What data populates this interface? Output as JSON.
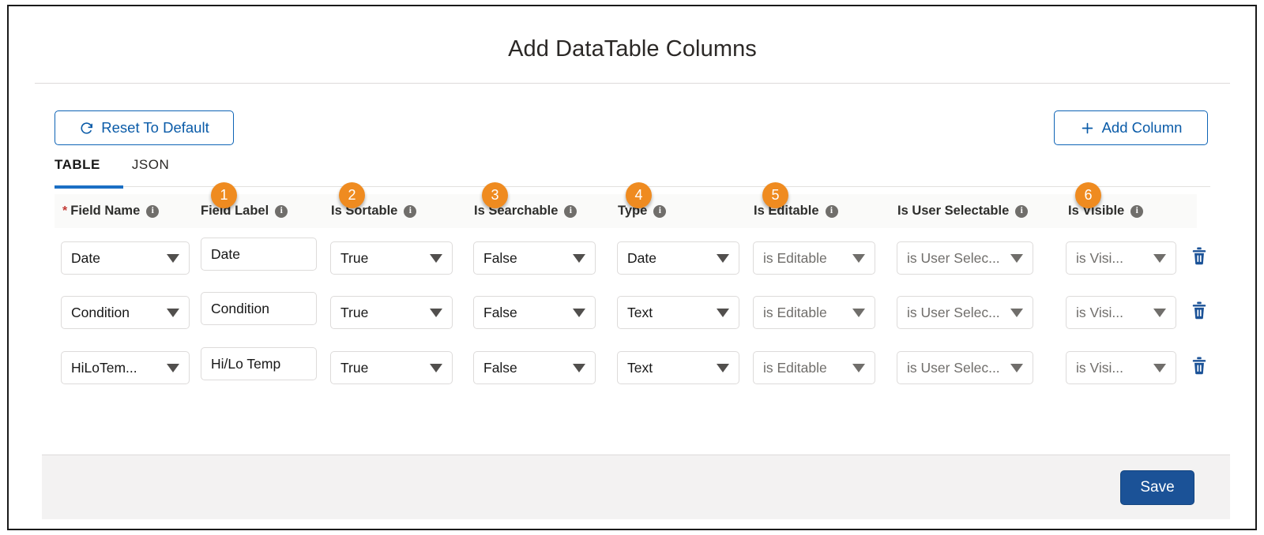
{
  "modal": {
    "title": "Add DataTable Columns"
  },
  "toolbar": {
    "reset_label": "Reset To Default",
    "reset_icon": "refresh-icon",
    "add_column_label": "Add Column",
    "add_column_icon": "plus-icon"
  },
  "tabs": [
    {
      "label": "TABLE",
      "active": true
    },
    {
      "label": "JSON",
      "active": false
    }
  ],
  "badges": [
    "1",
    "2",
    "3",
    "4",
    "5",
    "6"
  ],
  "table": {
    "columns": [
      {
        "label": "Field Name",
        "required": true,
        "info": true,
        "badge": null
      },
      {
        "label": "Field Label",
        "required": false,
        "info": true,
        "badge": "1"
      },
      {
        "label": "Is Sortable",
        "required": false,
        "info": true,
        "badge": "2"
      },
      {
        "label": "Is Searchable",
        "required": false,
        "info": true,
        "badge": "3"
      },
      {
        "label": "Type",
        "required": false,
        "info": true,
        "badge": "4"
      },
      {
        "label": "Is Editable",
        "required": false,
        "info": true,
        "badge": "5"
      },
      {
        "label": "Is User Selectable",
        "required": false,
        "info": true,
        "badge": null
      },
      {
        "label": "Is Visible",
        "required": false,
        "info": true,
        "badge": "6"
      }
    ],
    "required_marker": "*",
    "info_glyph": "i",
    "rows": [
      {
        "field_name": "Date",
        "field_label": "Date",
        "is_sortable": "True",
        "is_searchable": "False",
        "type": "Date",
        "is_editable": "is Editable",
        "is_user_selectable": "is User Selec...",
        "is_visible": "is Visi...",
        "delete_icon": "trash-icon"
      },
      {
        "field_name": "Condition",
        "field_label": "Condition",
        "is_sortable": "True",
        "is_searchable": "False",
        "type": "Text",
        "is_editable": "is Editable",
        "is_user_selectable": "is User Selec...",
        "is_visible": "is Visi...",
        "delete_icon": "trash-icon"
      },
      {
        "field_name": "HiLoTem...",
        "field_label": "Hi/Lo Temp",
        "is_sortable": "True",
        "is_searchable": "False",
        "type": "Text",
        "is_editable": "is Editable",
        "is_user_selectable": "is User Selec...",
        "is_visible": "is Visi...",
        "delete_icon": "trash-icon"
      }
    ]
  },
  "footer": {
    "save_label": "Save"
  },
  "colors": {
    "badge": "#ef8b20",
    "brand_blue": "#0d63b5",
    "save_blue": "#1b5297",
    "required_red": "#c23934",
    "header_bg": "#fafaf9",
    "footer_bg": "#f3f2f2",
    "border": "#dddbda",
    "trash_blue": "#1b5297"
  }
}
